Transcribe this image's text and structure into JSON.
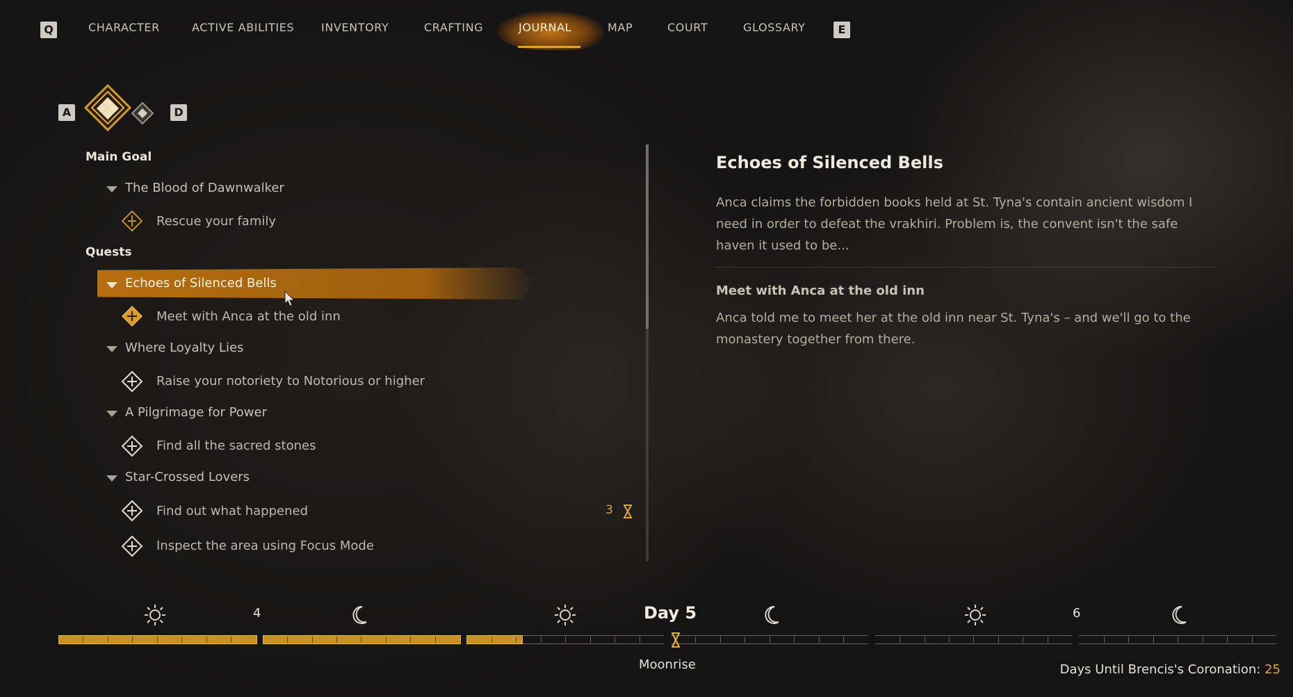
{
  "nav": {
    "left_key": "Q",
    "right_key": "E",
    "tabs": [
      {
        "label": "CHARACTER"
      },
      {
        "label": "ACTIVE ABILITIES"
      },
      {
        "label": "INVENTORY"
      },
      {
        "label": "CRAFTING"
      },
      {
        "label": "JOURNAL",
        "active": true
      },
      {
        "label": "MAP"
      },
      {
        "label": "COURT"
      },
      {
        "label": "GLOSSARY"
      }
    ]
  },
  "filters": {
    "left_key": "A",
    "right_key": "D"
  },
  "journal": {
    "main_goal_heading": "Main Goal",
    "main_quest": "The Blood of Dawnwalker",
    "main_objective": "Rescue your family",
    "quests_heading": "Quests",
    "quests": [
      {
        "title": "Echoes of Silenced Bells",
        "selected": true,
        "objectives": [
          {
            "text": "Meet with Anca at the old inn",
            "tracked": true
          }
        ]
      },
      {
        "title": "Where Loyalty Lies",
        "objectives": [
          {
            "text": "Raise your notoriety to Notorious or higher"
          }
        ]
      },
      {
        "title": "A Pilgrimage for Power",
        "objectives": [
          {
            "text": "Find all the sacred stones"
          }
        ]
      },
      {
        "title": "Star-Crossed Lovers",
        "objectives": [
          {
            "text": "Find out what happened",
            "timer": "3"
          },
          {
            "text": "Inspect the area using Focus Mode"
          }
        ]
      }
    ]
  },
  "detail": {
    "title": "Echoes of Silenced Bells",
    "description": "Anca claims the forbidden books held at St. Tyna's contain ancient wisdom I need in order to defeat the vrakhiri. Problem is, the convent isn't the safe haven it used to be...",
    "objective_title": "Meet with Anca at the old inn",
    "objective_text": "Anca told me to meet her at the old inn near St. Tyna's – and we'll go to the monastery together from there."
  },
  "timeline": {
    "prev_day": "4",
    "day_label": "Day 5",
    "next_day": "6",
    "phase": "Moonrise",
    "coronation_label": "Days Until Brencis's Coronation:",
    "coronation_days": "25",
    "progress_fraction": 0.38
  },
  "colors": {
    "accent": "#e0a43a",
    "highlight": "#be730f",
    "bar_fill": "#c8921e"
  }
}
